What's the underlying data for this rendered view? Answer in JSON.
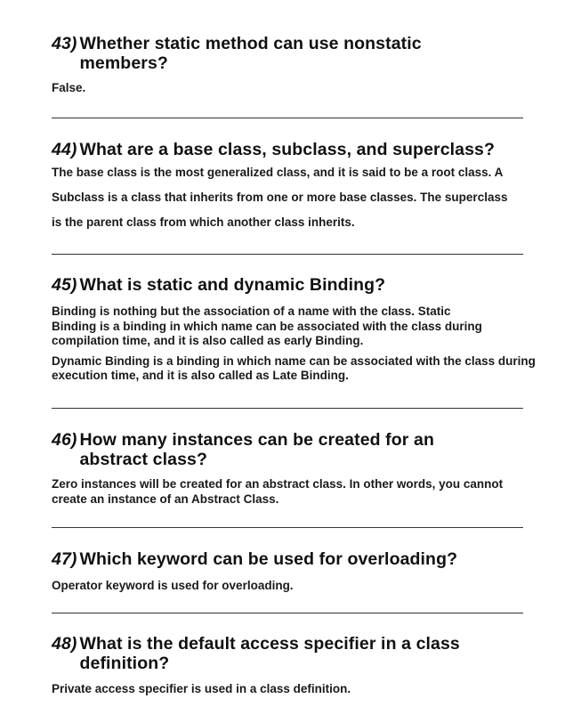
{
  "items": [
    {
      "number": "43)",
      "question": "Whether static method can use nonstatic members?",
      "answer": [
        "False."
      ]
    },
    {
      "number": "44)",
      "question": "What are a base class, subclass, and superclass?",
      "answer": [
        "The base class is the most generalized class, and it is said to be a root class. A Subclass is a class that inherits from one or more base classes. The superclass is the parent class from which another class inherits."
      ]
    },
    {
      "number": "45)",
      "question": "What is static and dynamic Binding?",
      "answer": [
        "Binding is nothing but the association of a name with the class. Static Binding is a binding in which name can be associated with the class during compilation time, and it is also called as early Binding.",
        "Dynamic Binding is a binding in which name can be associated with the class during execution time, and it is also called as Late Binding."
      ]
    },
    {
      "number": "46)",
      "question": "How many instances can be created for an abstract class?",
      "answer": [
        "Zero instances will be created for an abstract class. In other words, you cannot create an instance of an Abstract Class."
      ]
    },
    {
      "number": "47)",
      "question": "Which keyword can be used for overloading?",
      "answer": [
        "Operator keyword is used for overloading."
      ]
    },
    {
      "number": "48)",
      "question": "What is the default access specifier in a class definition?",
      "answer": [
        "Private access specifier is used in a class definition."
      ]
    }
  ]
}
